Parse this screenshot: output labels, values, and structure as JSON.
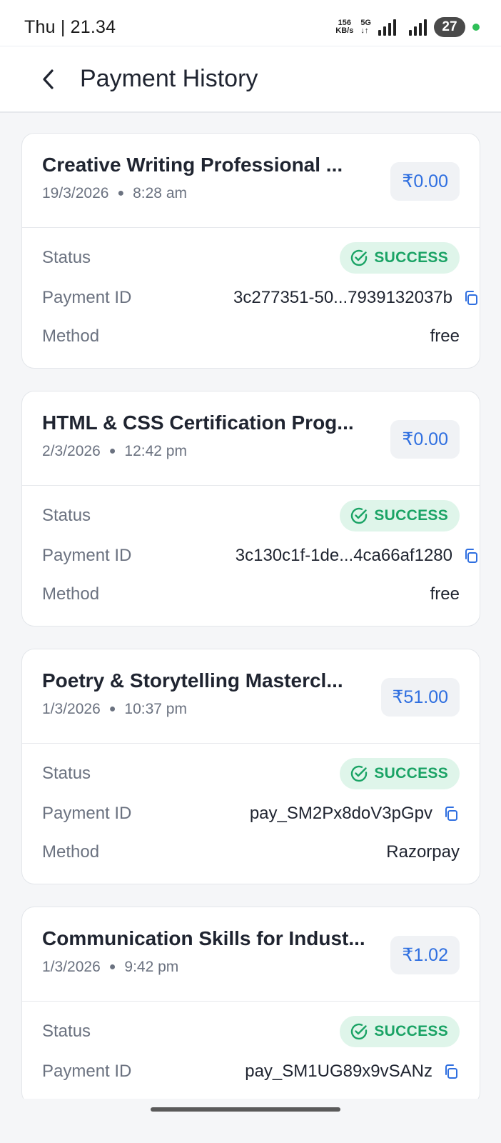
{
  "status_bar": {
    "time": "Thu | 21.34",
    "net_speed_value": "156",
    "net_speed_unit": "KB/s",
    "network_type": "5G",
    "battery": "27"
  },
  "header": {
    "title": "Payment History"
  },
  "labels": {
    "status": "Status",
    "payment_id": "Payment ID",
    "method": "Method"
  },
  "payments": [
    {
      "title": "Creative Writing Professional ...",
      "date": "19/3/2026",
      "time": "8:28 am",
      "amount": "₹0.00",
      "status": "SUCCESS",
      "payment_id": "3c277351-50...7939132037b",
      "method": "free"
    },
    {
      "title": "HTML & CSS Certification Prog...",
      "date": "2/3/2026",
      "time": "12:42 pm",
      "amount": "₹0.00",
      "status": "SUCCESS",
      "payment_id": "3c130c1f-1de...4ca66af1280",
      "method": "free"
    },
    {
      "title": "Poetry & Storytelling Mastercl...",
      "date": "1/3/2026",
      "time": "10:37 pm",
      "amount": "₹51.00",
      "status": "SUCCESS",
      "payment_id": "pay_SM2Px8doV3pGpv",
      "method": "Razorpay"
    },
    {
      "title": "Communication Skills for Indust...",
      "date": "1/3/2026",
      "time": "9:42 pm",
      "amount": "₹1.02",
      "status": "SUCCESS",
      "payment_id": "pay_SM1UG89x9vSANz",
      "method": ""
    }
  ],
  "colors": {
    "accent": "#2f6fe0",
    "success": "#1aa365",
    "success_bg": "#dff5ea",
    "page_bg": "#f5f6f8"
  },
  "icons": {
    "back": "arrow-left-icon",
    "status": "check-circle-icon",
    "copy": "copy-icon"
  }
}
